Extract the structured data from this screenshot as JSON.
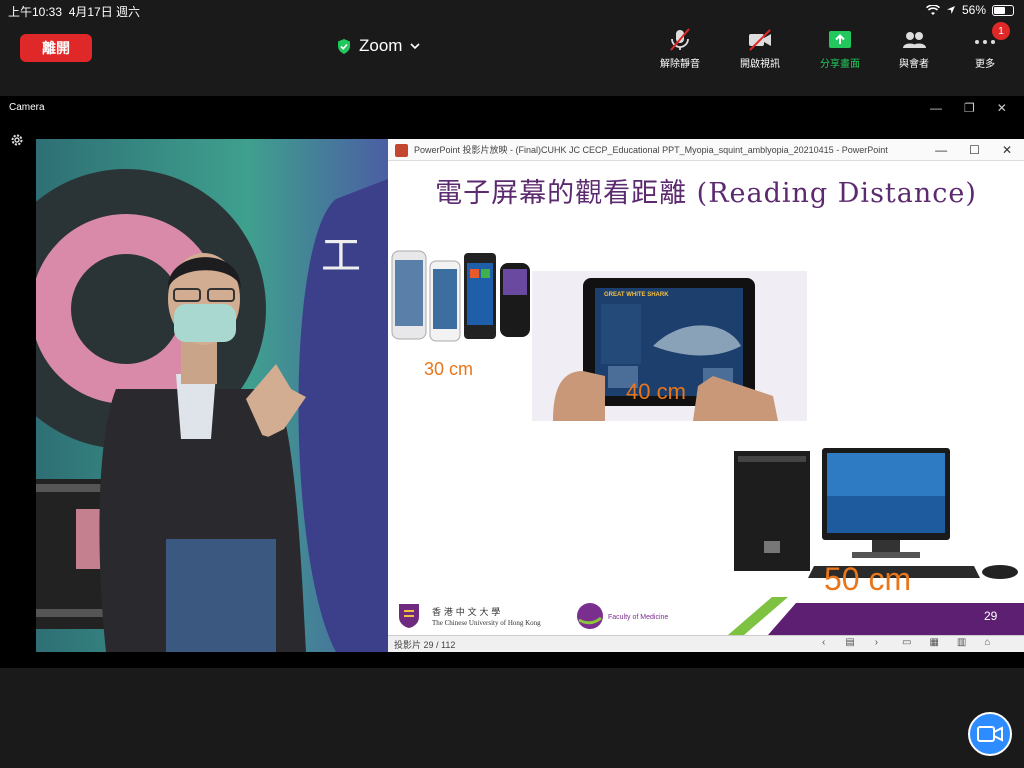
{
  "status": {
    "time": "上午10:33",
    "date": "4月17日 週六",
    "battery": "56%"
  },
  "toolbar": {
    "leave": "離開",
    "app_title": "Zoom",
    "unmute": "解除靜音",
    "start_video": "開啟視訊",
    "share": "分享畫面",
    "participants": "與會者",
    "more": "更多",
    "more_badge": "1"
  },
  "camera": {
    "label": "Camera"
  },
  "ppt": {
    "window_title": "PowerPoint 投影片放映 - (Final)CUHK JC CECP_Educational PPT_Myopia_squint_amblyopia_20210415 - PowerPoint",
    "slide_title": "電子屏幕的觀看距離 (Reading Distance)",
    "phone_distance": "30 cm",
    "tablet_distance": "40 cm",
    "pc_distance": "50 cm",
    "tablet_screen_title": "GREAT WHITE SHARK",
    "cuhk_name_zh": "香 港 中 文 大 學",
    "cuhk_name_en": "The Chinese University of Hong Kong",
    "faculty_name": "Faculty of Medicine",
    "slide_number": "29",
    "slide_counter": "投影片 29 / 112"
  },
  "colors": {
    "accent": "#2d8cff",
    "leave": "#e02828",
    "share": "#23c85c",
    "title": "#5c2a6f",
    "distance": "#e8761a"
  }
}
